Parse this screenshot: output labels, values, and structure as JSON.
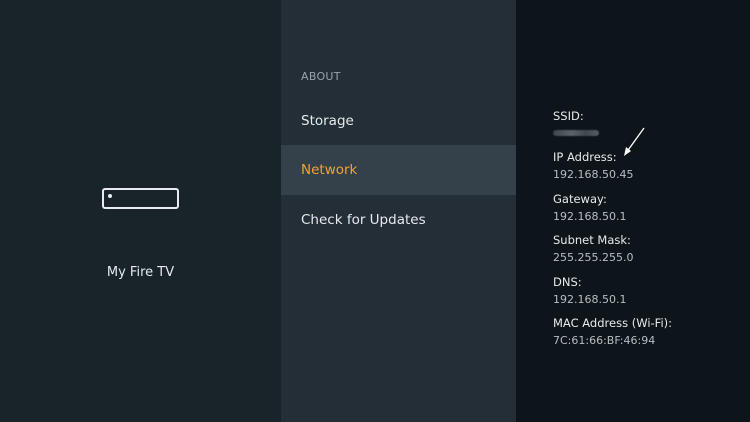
{
  "left_pane": {
    "device_icon": "fire-tv-stick-icon",
    "device_label": "My Fire TV"
  },
  "menu": {
    "section_heading": "ABOUT",
    "items": [
      {
        "label": "Storage",
        "selected": false
      },
      {
        "label": "Network",
        "selected": true
      },
      {
        "label": "Check for Updates",
        "selected": false
      }
    ]
  },
  "network_info": {
    "ssid": {
      "label": "SSID:",
      "value_redacted": true
    },
    "ip_address": {
      "label": "IP Address:",
      "value": "192.168.50.45"
    },
    "gateway": {
      "label": "Gateway:",
      "value": "192.168.50.1"
    },
    "subnet_mask": {
      "label": "Subnet Mask:",
      "value": "255.255.255.0"
    },
    "dns": {
      "label": "DNS:",
      "value": "192.168.50.1"
    },
    "mac_address": {
      "label": "MAC Address (Wi-Fi):",
      "value": "7C:61:66:BF:46:94"
    }
  },
  "annotation": {
    "icon": "arrow-pointer-icon",
    "color": "#ffffff"
  },
  "colors": {
    "accent": "#f0a434",
    "selected_bg": "#34404a"
  }
}
